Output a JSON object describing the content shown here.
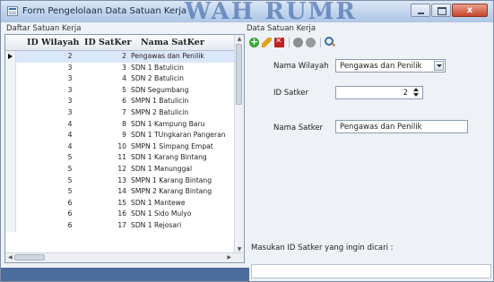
{
  "window": {
    "title": "Form Pengelolaan Data Satuan Kerja",
    "background_watermark": "WAH RUMR",
    "close_glyph": "x"
  },
  "left_panel": {
    "title": "Daftar Satuan Kerja",
    "columns": [
      "ID Wilayah",
      "ID SatKer",
      "Nama SatKer"
    ],
    "rows": [
      {
        "id_wilayah": "2",
        "id_satker": "2",
        "nama": "Pengawas dan Penilik"
      },
      {
        "id_wilayah": "3",
        "id_satker": "3",
        "nama": "SDN 1 Batulicin"
      },
      {
        "id_wilayah": "3",
        "id_satker": "4",
        "nama": "SDN 2 Batulicin"
      },
      {
        "id_wilayah": "3",
        "id_satker": "5",
        "nama": "SDN Segumbang"
      },
      {
        "id_wilayah": "3",
        "id_satker": "6",
        "nama": "SMPN 1 Batulicin"
      },
      {
        "id_wilayah": "3",
        "id_satker": "7",
        "nama": "SMPN 2 Batulicin"
      },
      {
        "id_wilayah": "4",
        "id_satker": "8",
        "nama": "SDN 1 Kampung Baru"
      },
      {
        "id_wilayah": "4",
        "id_satker": "9",
        "nama": "SDN 1 TUngkaran Pangeran"
      },
      {
        "id_wilayah": "4",
        "id_satker": "10",
        "nama": "SMPN 1 Simpang Empat"
      },
      {
        "id_wilayah": "5",
        "id_satker": "11",
        "nama": "SDN 1 Karang Bintang"
      },
      {
        "id_wilayah": "5",
        "id_satker": "12",
        "nama": "SDN 1 Manunggal"
      },
      {
        "id_wilayah": "5",
        "id_satker": "13",
        "nama": "SMPN 1 Karang Bintang"
      },
      {
        "id_wilayah": "5",
        "id_satker": "14",
        "nama": "SMPN 2 Karang Bintang"
      },
      {
        "id_wilayah": "6",
        "id_satker": "15",
        "nama": "SDN 1 Mantewe"
      },
      {
        "id_wilayah": "6",
        "id_satker": "16",
        "nama": "SDN 1 Sido Mulyo"
      },
      {
        "id_wilayah": "6",
        "id_satker": "17",
        "nama": "SDN 1 Rejosari"
      }
    ]
  },
  "right_panel": {
    "title": "Data Satuan Kerja",
    "toolbar": [
      "add-icon",
      "edit-icon",
      "delete-icon",
      "save-icon",
      "cancel-icon",
      "search-icon"
    ],
    "nama_wilayah_label": "Nama Wilayah",
    "nama_wilayah_value": "Pengawas dan Penilik",
    "id_satker_label": "ID Satker",
    "id_satker_value": "2",
    "nama_satker_label": "Nama Satker",
    "nama_satker_value": "Pengawas dan Penilik",
    "search_prompt": "Masukan ID Satker yang ingin dicari :",
    "search_value": ""
  },
  "colors": {
    "title_bar": "#c4d6ee",
    "selected_row": "#dbe7fa",
    "close_button": "#c4442c"
  }
}
